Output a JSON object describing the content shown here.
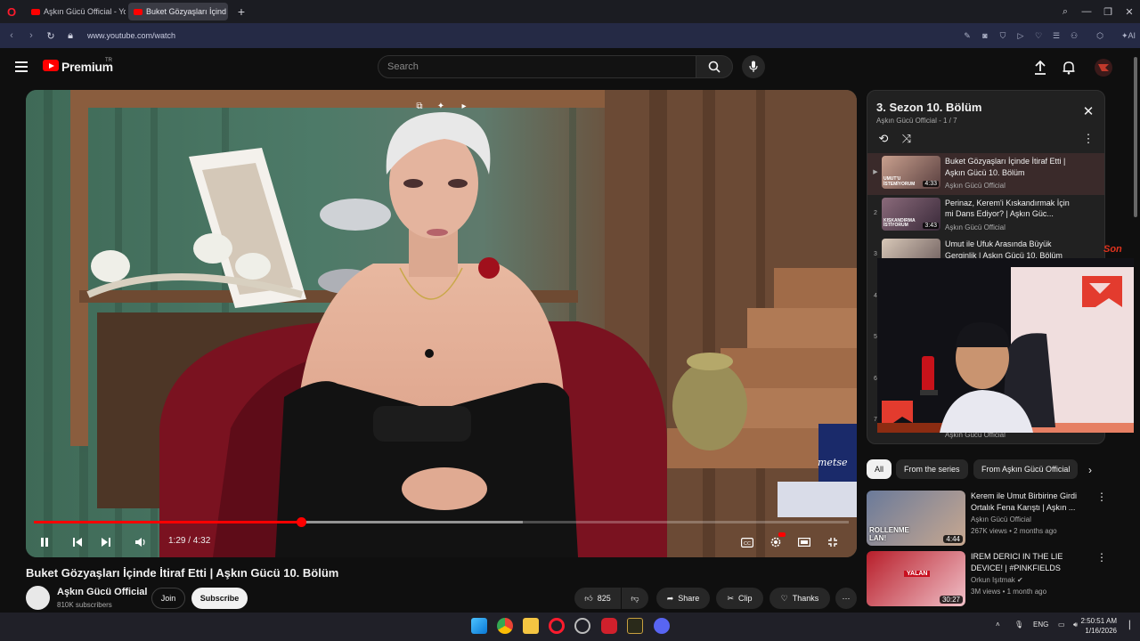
{
  "browser": {
    "tabs": [
      {
        "label": "Aşkın Gücü Official - YouT"
      },
      {
        "label": "Buket Gözyaşları İçind"
      }
    ],
    "url": "www.youtube.com/watch"
  },
  "header": {
    "logo_text": "Premium",
    "region": "TR",
    "search_placeholder": "Search"
  },
  "player": {
    "current_time": "1:29",
    "duration": "4:32",
    "time_display": "1:29 / 4:32",
    "progress_fraction": 0.328,
    "buffer_fraction": 0.6,
    "overlay_text": "metse"
  },
  "video": {
    "title": "Buket Gözyaşları İçinde İtiraf Etti | Aşkın Gücü 10. Bölüm",
    "channel": "Aşkın Gücü Official",
    "subscribers": "810K subscribers",
    "join_label": "Join",
    "subscribe_label": "Subscribe",
    "likes": "825",
    "share_label": "Share",
    "clip_label": "Clip",
    "thanks_label": "Thanks"
  },
  "playlist": {
    "title": "3. Sezon 10. Bölüm",
    "subtitle": "Aşkın Gücü Official - 1 / 7",
    "items": [
      {
        "num": "▶",
        "title": "Buket Gözyaşları İçinde İtiraf Etti | Aşkın Gücü 10. Bölüm",
        "channel": "Aşkın Gücü Official",
        "duration": "4:33",
        "thumb_caption": "UMUT'U İSTEMİYORUM"
      },
      {
        "num": "2",
        "title": "Perinaz, Kerem'i Kıskandırmak İçin mi Dans Ediyor? | Aşkın Güc...",
        "channel": "Aşkın Gücü Official",
        "duration": "3:43",
        "thumb_caption": "KISKANDIRMA İSTİYORUM"
      },
      {
        "num": "3",
        "title": "Umut ile Ufuk Arasında Büyük Gerginlik | Aşkın Gücü 10. Bölüm",
        "channel": "",
        "duration": "",
        "thumb_caption": ""
      },
      {
        "num": "4",
        "title": "",
        "channel": "",
        "duration": "",
        "thumb_caption": ""
      },
      {
        "num": "5",
        "title": "",
        "channel": "",
        "duration": "",
        "thumb_caption": ""
      },
      {
        "num": "6",
        "title": "",
        "channel": "",
        "duration": "",
        "thumb_caption": ""
      },
      {
        "num": "7",
        "title": "",
        "channel": "Aşkın Gücü Official",
        "duration": "",
        "thumb_caption": ""
      }
    ]
  },
  "webcam": {
    "son_text": "Son"
  },
  "chips": [
    "All",
    "From the series",
    "From Aşkın Gücü Official"
  ],
  "recommended": [
    {
      "title": "Kerem ile Umut Birbirine Girdi Ortalık Fena Karıştı | Aşkın ...",
      "channel": "Aşkın Gücü Official",
      "meta": "267K views • 2 months ago",
      "duration": "4:44",
      "thumb_caption": "ROLLENME LAN!"
    },
    {
      "title": "IREM DERICI IN THE LIE DEVICE! | #PINKFIELDS",
      "channel": "Orkun Işıtmak ✔",
      "meta": "3M views • 1 month ago",
      "duration": "30:27",
      "thumb_caption": "YALAN"
    }
  ],
  "taskbar": {
    "lang": "ENG",
    "time": "2:50:51 AM",
    "date": "1/16/2026"
  },
  "colors": {
    "accent": "#ff0000",
    "background": "#0f0f0f"
  }
}
